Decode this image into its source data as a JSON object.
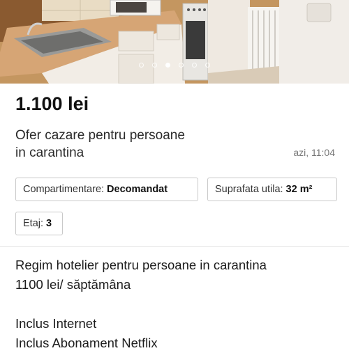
{
  "gallery": {
    "photo_count": 6,
    "active_index": 2
  },
  "listing": {
    "price": "1.100 lei",
    "title_line1": "Ofer cazare pentru persoane",
    "title_line2": "in carantina",
    "posted": "azi, 11:04"
  },
  "attributes": [
    {
      "label": "Compartimentare:",
      "value": "Decomandat"
    },
    {
      "label": "Suprafata utila:",
      "value": "32 m²"
    },
    {
      "label": "Etaj:",
      "value": "3"
    }
  ],
  "description": {
    "lines": [
      "Regim hotelier pentru persoane in carantina",
      "1100 lei/ săptămâna",
      "",
      "Inclus Internet",
      "Inclus Abonament Netflix"
    ]
  }
}
